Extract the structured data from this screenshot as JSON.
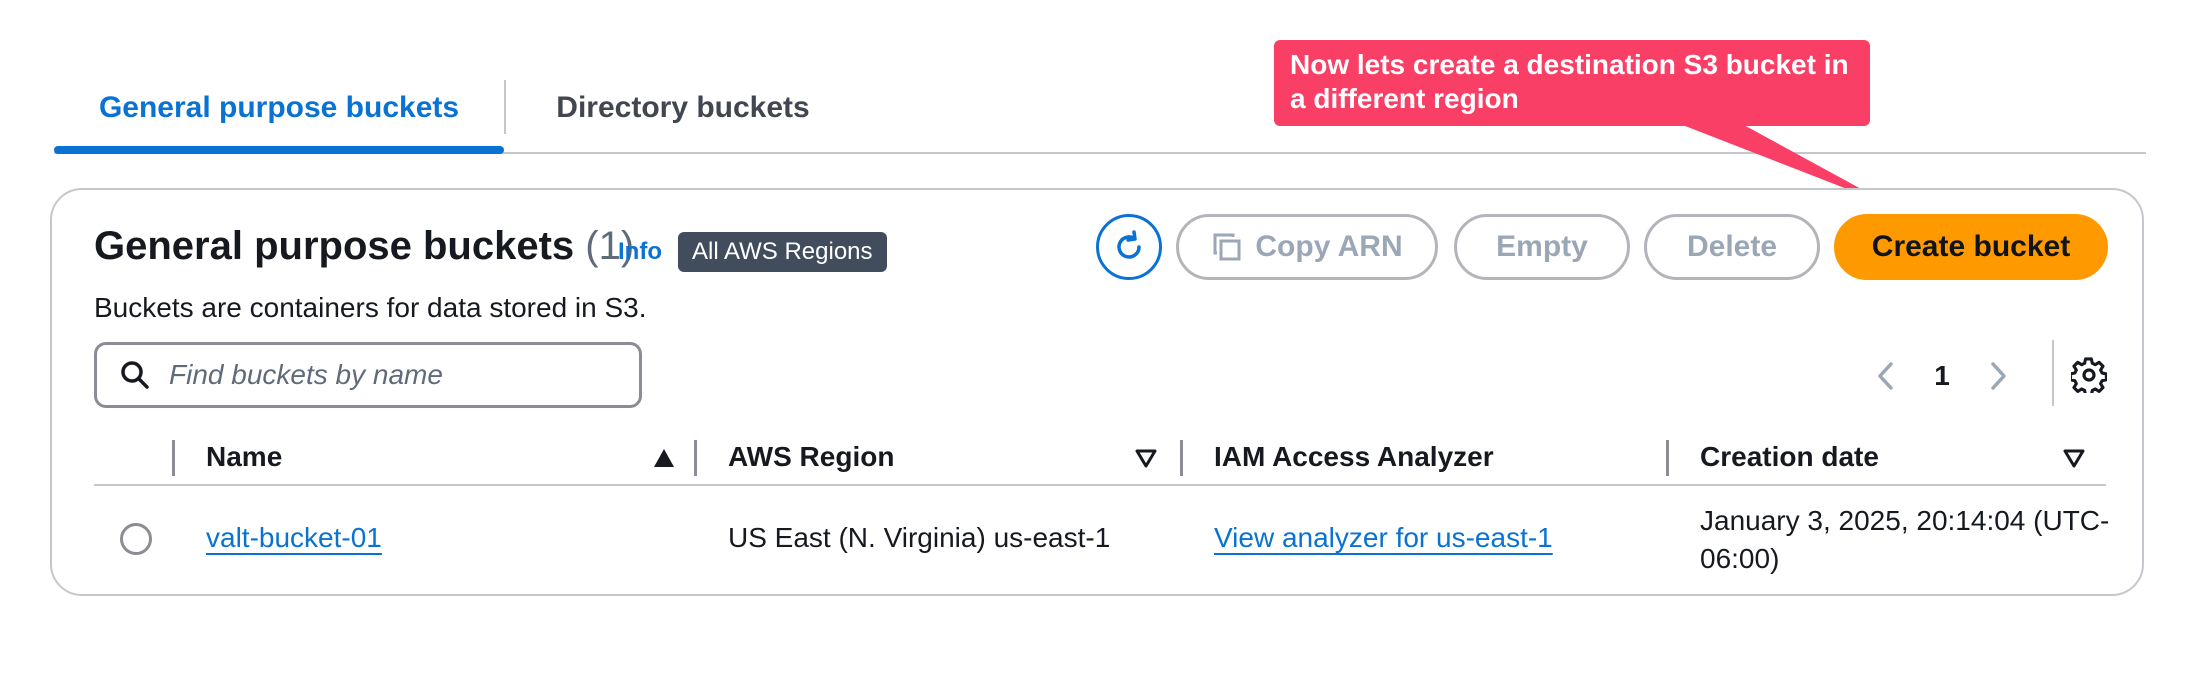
{
  "tabs": {
    "general": "General purpose buckets",
    "directory": "Directory buckets"
  },
  "callout": {
    "text": "Now lets create a destination S3 bucket in a different region",
    "color": "#fa3f66"
  },
  "panel": {
    "title": "General purpose buckets",
    "count": "(1)",
    "info": "Info",
    "region_badge": "All AWS Regions",
    "description": "Buckets are containers for data stored in S3."
  },
  "toolbar": {
    "refresh_icon": "refresh-icon",
    "copy_arn": "Copy ARN",
    "empty": "Empty",
    "delete": "Delete",
    "create": "Create bucket",
    "create_color": "#ff9900"
  },
  "search": {
    "placeholder": "Find buckets by name",
    "value": ""
  },
  "pagination": {
    "current_page": "1"
  },
  "table": {
    "columns": [
      "Name",
      "AWS Region",
      "IAM Access Analyzer",
      "Creation date"
    ],
    "rows": [
      {
        "name": "valt-bucket-01",
        "region": "US East (N. Virginia) us-east-1",
        "analyzer": "View analyzer for us-east-1",
        "created": "January 3, 2025, 20:14:04 (UTC-06:00)"
      }
    ]
  },
  "colors": {
    "link": "#0972d3",
    "accent": "#ff9900"
  }
}
